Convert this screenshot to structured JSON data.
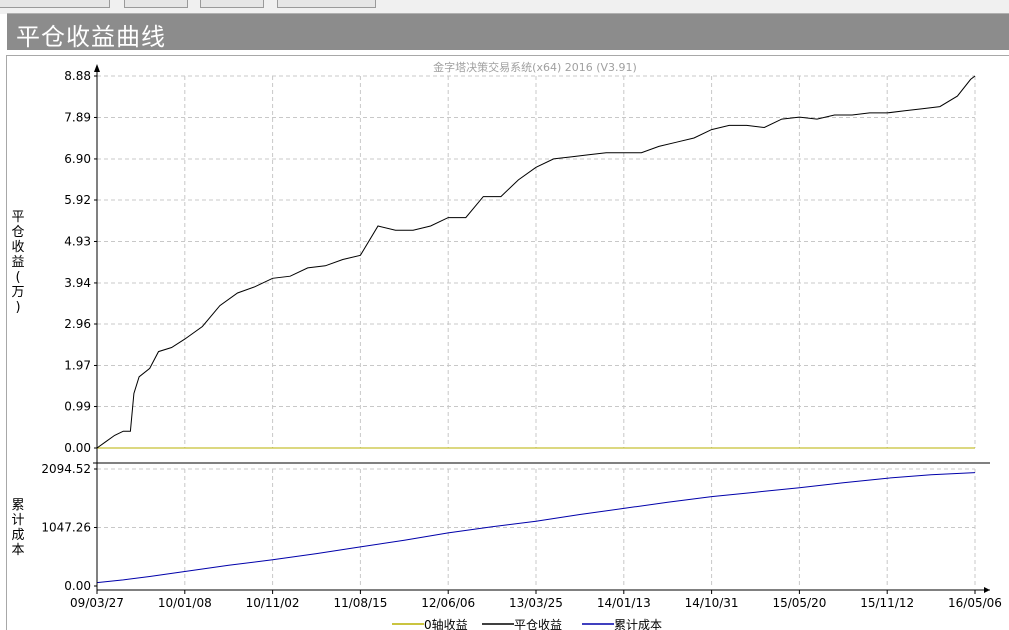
{
  "window": {
    "title": "平仓收益曲线"
  },
  "chart_data": {
    "type": "line",
    "watermark": "金字塔决策交易系统(x64) 2016 (V3.91)",
    "x_ticks": [
      "09/03/27",
      "10/01/08",
      "10/11/02",
      "11/08/15",
      "12/06/06",
      "13/03/25",
      "14/01/13",
      "14/10/31",
      "15/05/20",
      "15/11/12",
      "16/05/06"
    ],
    "panels": [
      {
        "id": "profit",
        "ylabel": "平仓收益(万)",
        "y_ticks": [
          0.0,
          0.99,
          1.97,
          2.96,
          3.94,
          4.93,
          5.92,
          6.9,
          7.89,
          8.88
        ],
        "ylim": [
          0,
          8.88
        ],
        "series": [
          {
            "name": "0轴收益",
            "color": "#b8b000",
            "x": [
              0,
              10
            ],
            "values": [
              0,
              0
            ]
          },
          {
            "name": "平仓收益",
            "color": "#000000",
            "x": [
              0,
              0.1,
              0.2,
              0.3,
              0.38,
              0.42,
              0.48,
              0.6,
              0.7,
              0.85,
              1.0,
              1.2,
              1.4,
              1.6,
              1.8,
              2.0,
              2.2,
              2.4,
              2.6,
              2.8,
              3.0,
              3.2,
              3.4,
              3.6,
              3.8,
              4.0,
              4.2,
              4.4,
              4.6,
              4.8,
              5.0,
              5.2,
              5.4,
              5.6,
              5.8,
              6.0,
              6.2,
              6.4,
              6.6,
              6.8,
              7.0,
              7.2,
              7.4,
              7.6,
              7.8,
              8.0,
              8.2,
              8.4,
              8.6,
              8.8,
              9.0,
              9.2,
              9.4,
              9.6,
              9.8,
              9.95,
              10.0
            ],
            "values": [
              0.0,
              0.15,
              0.3,
              0.4,
              0.4,
              1.3,
              1.7,
              1.9,
              2.3,
              2.4,
              2.6,
              2.9,
              3.4,
              3.7,
              3.85,
              4.05,
              4.1,
              4.3,
              4.35,
              4.5,
              4.6,
              5.3,
              5.2,
              5.2,
              5.3,
              5.5,
              5.5,
              6.0,
              6.0,
              6.4,
              6.7,
              6.9,
              6.95,
              7.0,
              7.05,
              7.05,
              7.05,
              7.2,
              7.3,
              7.4,
              7.6,
              7.7,
              7.7,
              7.65,
              7.85,
              7.9,
              7.85,
              7.95,
              7.95,
              8.0,
              8.0,
              8.05,
              8.1,
              8.15,
              8.4,
              8.8,
              8.88
            ]
          }
        ]
      },
      {
        "id": "cost",
        "ylabel": "累计成本",
        "y_ticks": [
          0.0,
          1047.26,
          2094.52
        ],
        "ylim": [
          0,
          2094.52
        ],
        "series": [
          {
            "name": "累计成本",
            "color": "#0000aa",
            "x": [
              0,
              0.3,
              0.6,
              1.0,
              1.5,
              2.0,
              2.5,
              3.0,
              3.5,
              4.0,
              4.5,
              5.0,
              5.5,
              6.0,
              6.5,
              7.0,
              7.5,
              8.0,
              8.5,
              9.0,
              9.5,
              10.0
            ],
            "values": [
              60,
              110,
              170,
              260,
              370,
              470,
              580,
              700,
              820,
              950,
              1060,
              1160,
              1280,
              1390,
              1500,
              1600,
              1680,
              1760,
              1850,
              1930,
              1990,
              2030
            ]
          }
        ]
      }
    ],
    "legend": [
      "0轴收益",
      "平仓收益",
      "累计成本"
    ],
    "grid": true
  }
}
